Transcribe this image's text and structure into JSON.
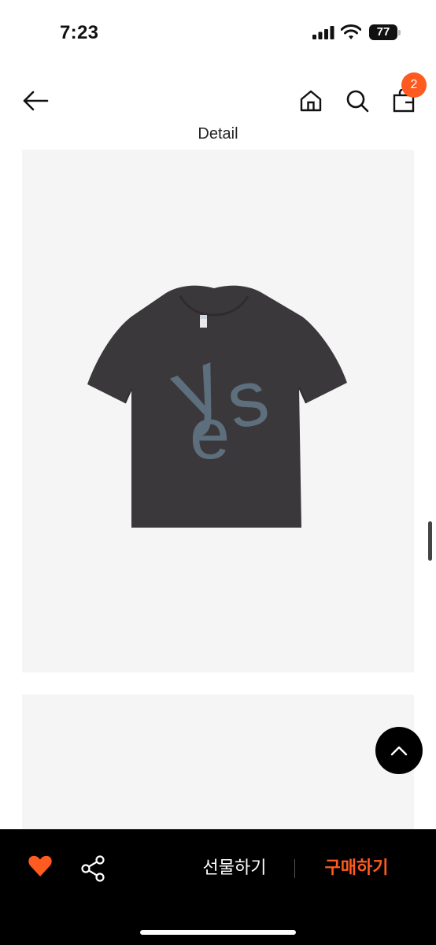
{
  "status_bar": {
    "time": "7:23",
    "battery_level": "77"
  },
  "nav": {
    "cart_count": "2"
  },
  "section": {
    "title": "Detail"
  },
  "product_image": {
    "print_text": "yes"
  },
  "bottom_bar": {
    "gift_label": "선물하기",
    "buy_label": "구매하기"
  },
  "colors": {
    "accent": "#ff5a1f",
    "bar_background": "#000000",
    "shirt": "#3b383c",
    "print": "#5d6f7c"
  },
  "icons": [
    "signal-icon",
    "wifi-icon",
    "battery-icon",
    "back-arrow-icon",
    "home-icon",
    "search-icon",
    "shopping-bag-icon",
    "scroll-to-top-icon",
    "heart-icon",
    "share-icon"
  ]
}
